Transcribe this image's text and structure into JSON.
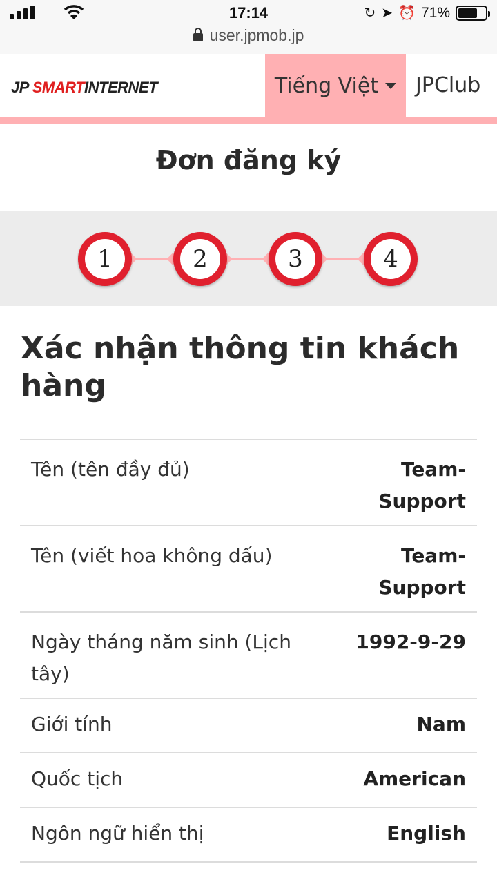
{
  "status_bar": {
    "time": "17:14",
    "battery": "71%",
    "battery_level": 0.71,
    "url": "user.jpmob.jp"
  },
  "header": {
    "logo_left": "JP ",
    "logo_red": "SMART",
    "logo_right": "INTERNET",
    "language": "Tiếng Việt",
    "club_link": "JPClub",
    "accent_color": "#ffb0b3"
  },
  "page_title": "Đơn đăng ký",
  "steps": [
    "1",
    "2",
    "3",
    "4"
  ],
  "section_title": "Xác nhận thông tin khách hàng",
  "info": [
    {
      "label": "Tên (tên đầy đủ)",
      "value": "Team-Support"
    },
    {
      "label": "Tên (viết hoa không dấu)",
      "value": "Team-Support"
    },
    {
      "label": "Ngày tháng năm sinh (Lịch tây)",
      "value": "1992-9-29"
    },
    {
      "label": "Giới tính",
      "value": "Nam"
    },
    {
      "label": "Quốc tịch",
      "value": "American"
    },
    {
      "label": "Ngôn ngữ hiển thị",
      "value": "English"
    }
  ]
}
